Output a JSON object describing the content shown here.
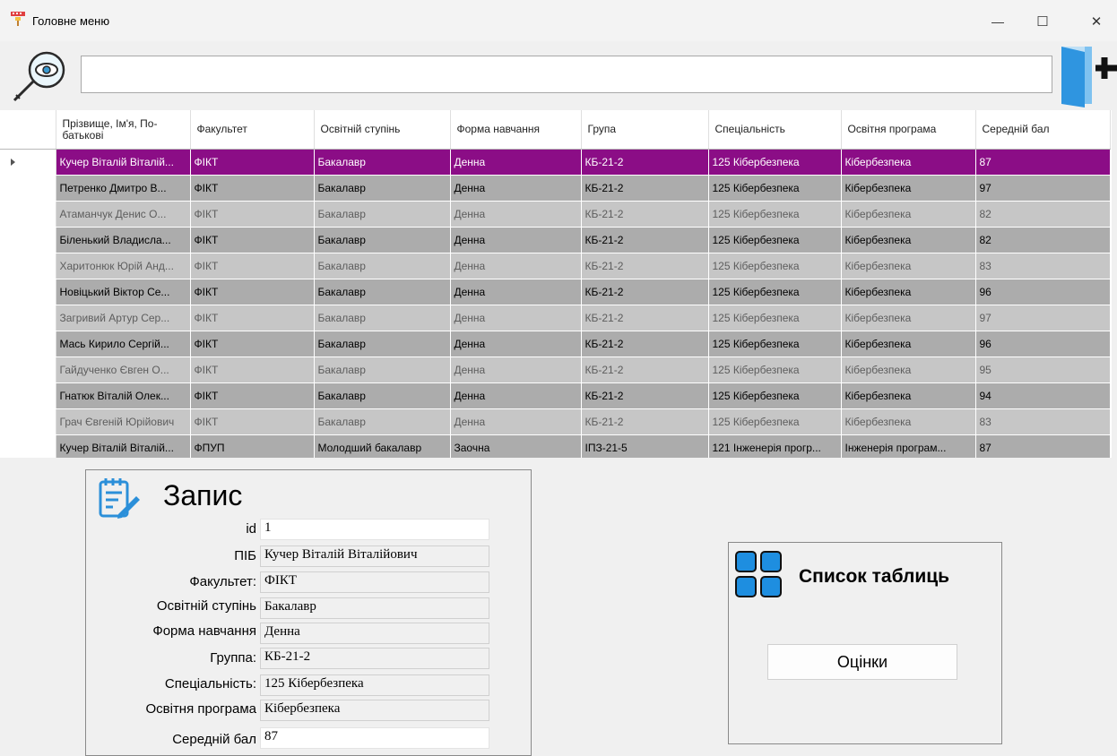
{
  "window": {
    "title": "Головне меню",
    "minimize_glyph": "—",
    "maximize_glyph": "☐",
    "close_glyph": "✕"
  },
  "search": {
    "value": "",
    "placeholder": ""
  },
  "icons": {
    "search": "search-eye-icon",
    "exit": "exit-door-icon",
    "record": "notepad-edit-icon",
    "tables": "grid-squares-icon",
    "accent": "#2b8fd9"
  },
  "grid": {
    "columns": [
      "Прізвище, Ім'я, По-батькові",
      "Факультет",
      "Освітній ступінь",
      "Форма навчання",
      "Група",
      "Спеціальність",
      "Освітня програма",
      "Середній бал"
    ],
    "rows": [
      {
        "style": "sel",
        "cells": [
          "Кучер Віталій Віталій...",
          "ФІКТ",
          "Бакалавр",
          "Денна",
          "КБ-21-2",
          "125 Кібербезпека",
          "Кібербезпека",
          "87"
        ]
      },
      {
        "style": "dark",
        "cells": [
          "Петренко Дмитро В...",
          "ФІКТ",
          "Бакалавр",
          "Денна",
          "КБ-21-2",
          "125 Кібербезпека",
          "Кібербезпека",
          "97"
        ]
      },
      {
        "style": "light",
        "cells": [
          "Атаманчук Денис О...",
          "ФІКТ",
          "Бакалавр",
          "Денна",
          "КБ-21-2",
          "125 Кібербезпека",
          "Кібербезпека",
          "82"
        ]
      },
      {
        "style": "dark",
        "cells": [
          "Біленький Владисла...",
          "ФІКТ",
          "Бакалавр",
          "Денна",
          "КБ-21-2",
          "125 Кібербезпека",
          "Кібербезпека",
          "82"
        ]
      },
      {
        "style": "light",
        "cells": [
          "Харитонюк Юрій Анд...",
          "ФІКТ",
          "Бакалавр",
          "Денна",
          "КБ-21-2",
          "125 Кібербезпека",
          "Кібербезпека",
          "83"
        ]
      },
      {
        "style": "dark",
        "cells": [
          "Новіцький Віктор Се...",
          "ФІКТ",
          "Бакалавр",
          "Денна",
          "КБ-21-2",
          "125 Кібербезпека",
          "Кібербезпека",
          "96"
        ]
      },
      {
        "style": "light",
        "cells": [
          "Загривий Артур Сер...",
          "ФІКТ",
          "Бакалавр",
          "Денна",
          "КБ-21-2",
          "125 Кібербезпека",
          "Кібербезпека",
          "97"
        ]
      },
      {
        "style": "dark",
        "cells": [
          "Мась Кирило Сергій...",
          "ФІКТ",
          "Бакалавр",
          "Денна",
          "КБ-21-2",
          "125 Кібербезпека",
          "Кібербезпека",
          "96"
        ]
      },
      {
        "style": "light",
        "cells": [
          "Гайдученко Євген О...",
          "ФІКТ",
          "Бакалавр",
          "Денна",
          "КБ-21-2",
          "125 Кібербезпека",
          "Кібербезпека",
          "95"
        ]
      },
      {
        "style": "dark",
        "cells": [
          "Гнатюк Віталій Олек...",
          "ФІКТ",
          "Бакалавр",
          "Денна",
          "КБ-21-2",
          "125 Кібербезпека",
          "Кібербезпека",
          "94"
        ]
      },
      {
        "style": "light",
        "cells": [
          "Грач Євгеній Юрійович",
          "ФІКТ",
          "Бакалавр",
          "Денна",
          "КБ-21-2",
          "125 Кібербезпека",
          "Кібербезпека",
          "83"
        ]
      },
      {
        "style": "dark",
        "cells": [
          "Кучер Віталій Віталій...",
          "ФПУП",
          "Молодший бакалавр",
          "Заочна",
          "ІПЗ-21-5",
          "121 Інженерія прогр...",
          "Інженерія програм...",
          "87"
        ]
      }
    ],
    "colors": {
      "selected": "#8b0d86",
      "dark_row": "#acacac",
      "light_row": "#c6c6c6"
    }
  },
  "record": {
    "title": "Запис",
    "fields": [
      {
        "label": "id",
        "value": "1"
      },
      {
        "label": "ПІБ",
        "value": "Кучер Віталій Віталійович"
      },
      {
        "label": "Факультет:",
        "value": "ФІКТ"
      },
      {
        "label": "Освітній ступінь",
        "value": "Бакалавр"
      },
      {
        "label": "Форма навчання",
        "value": "Денна"
      },
      {
        "label": "Группа:",
        "value": "КБ-21-2"
      },
      {
        "label": "Спеціальність:",
        "value": "125 Кібербезпека"
      },
      {
        "label": "Освітня програма",
        "value": "Кібербезпека"
      },
      {
        "label": "Середній бал",
        "value": "87"
      }
    ]
  },
  "tables_panel": {
    "title": "Список таблиць",
    "grades_button": "Оцінки"
  }
}
